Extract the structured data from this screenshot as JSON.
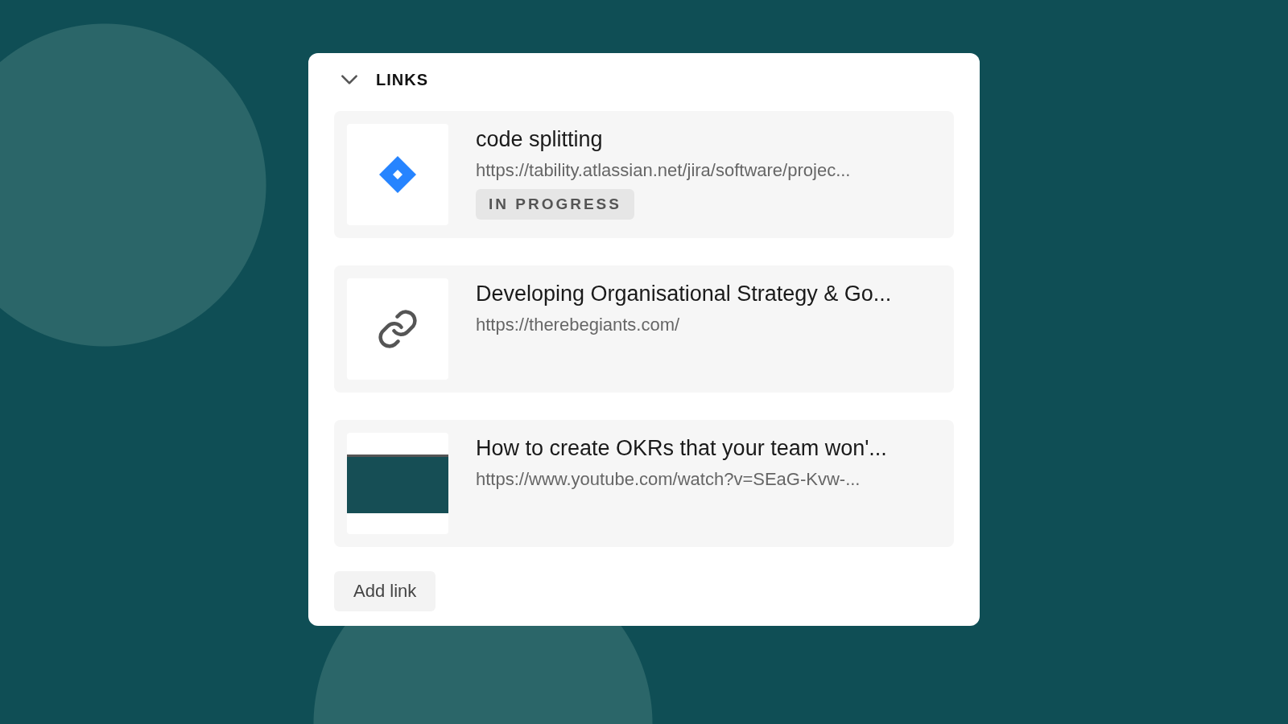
{
  "section": {
    "title": "LINKS",
    "expanded": true
  },
  "links": [
    {
      "kind": "jira",
      "title": "code splitting",
      "url": "https://tability.atlassian.net/jira/software/projec...",
      "status": "IN PROGRESS"
    },
    {
      "kind": "link",
      "title": "Developing Organisational Strategy & Go...",
      "url": "https://therebegiants.com/"
    },
    {
      "kind": "video",
      "title": "How to create OKRs that your team won'...",
      "url": "https://www.youtube.com/watch?v=SEaG-Kvw-..."
    }
  ],
  "add_button": "Add link"
}
